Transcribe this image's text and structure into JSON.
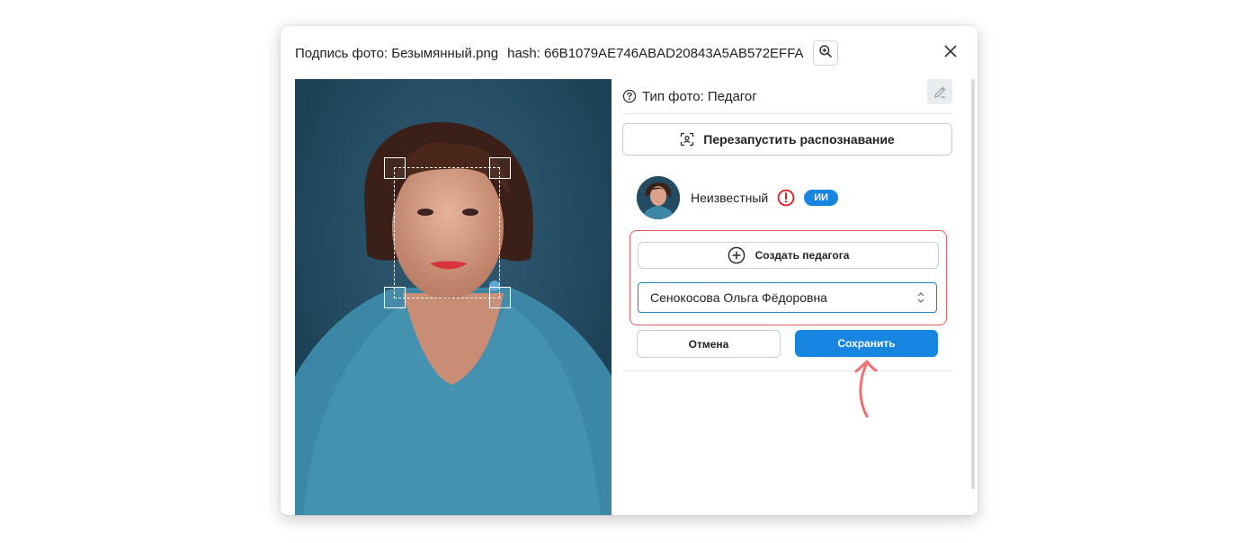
{
  "modal": {
    "title": "Подпись фото: Безымянный.png",
    "hash": "hash: 66B1079AE746ABAD20843A5AB572EFFA",
    "zoom_icon": "zoom-in-icon",
    "close_icon": "close-icon"
  },
  "photo": {
    "face_box_handles": 4
  },
  "panel": {
    "type_label": "Тип фото: Педагог",
    "help_icon": "question-circle-icon",
    "edit_icon": "pencil-icon",
    "restart_label": "Перезапустить распознавание",
    "restart_icon": "face-scan-icon",
    "person": {
      "name": "Неизвестный",
      "alert_icon": "exclamation-circle-icon",
      "badge": "ИИ"
    },
    "create_label": "Создать педагога",
    "create_icon": "plus-circle-icon",
    "select_value": "Сенокосова Ольга Фёдоровна",
    "select_icon": "chevron-updown-icon",
    "cancel_label": "Отмена",
    "save_label": "Сохранить"
  },
  "colors": {
    "accent": "#1585e0",
    "highlight": "#ea5b5b",
    "alert": "#e02020",
    "arrow": "#f07070"
  }
}
